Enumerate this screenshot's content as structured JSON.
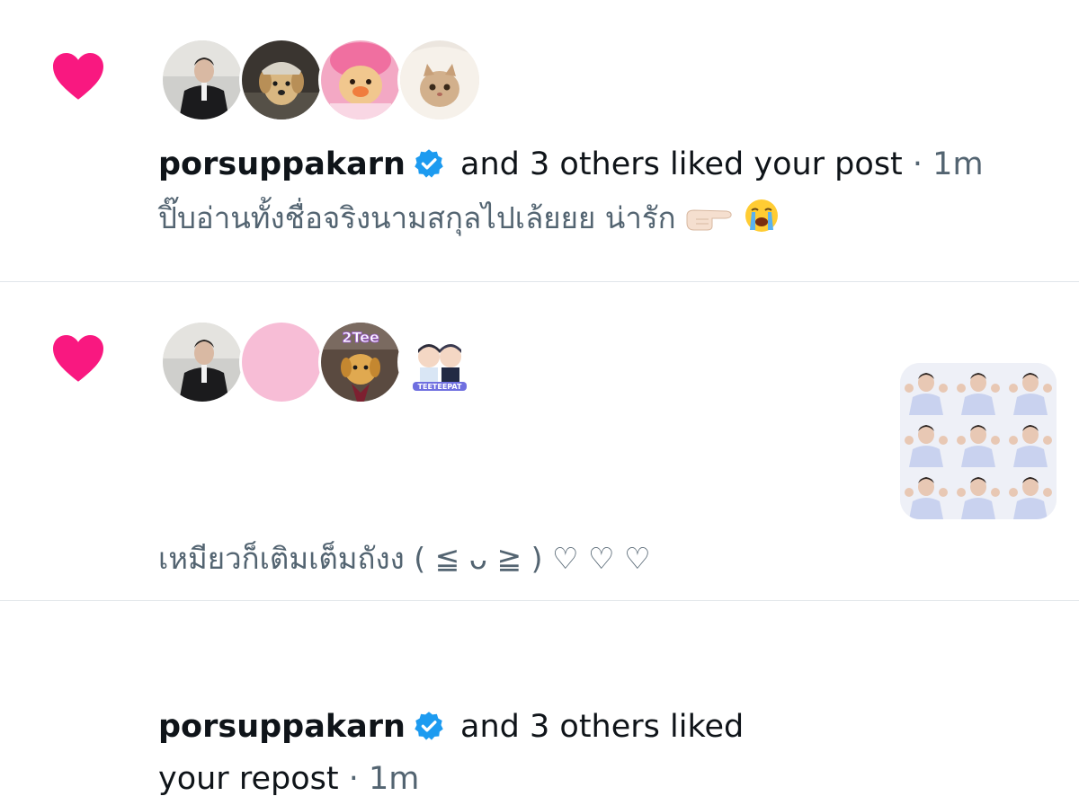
{
  "notifications": [
    {
      "username": "porsuppakarn",
      "action": " and 3 others liked your post",
      "separator": " · ",
      "time": "1m",
      "preview": "ปิ๊บอ่านทั้งชื่อจริงนามสกุลไปเล้ยยย น่ารัก",
      "preview_emoji": [
        "backhand-index-pointing-right",
        "loudly-crying-face"
      ],
      "avatars": [
        "person-dark-jacket",
        "puppy-with-cap",
        "plush-toy-pink",
        "cat-in-blanket"
      ]
    },
    {
      "username": "porsuppakarn",
      "action": " and 3 others liked",
      "action_cont": "your repost",
      "separator": " · ",
      "time": "1m",
      "preview": "เหมียวก็เติมเต็มถังง ( ≦ ᴗ ≧ ) ♡ ♡ ♡",
      "avatars": [
        "person-dark-jacket",
        "pink-blank",
        "puppy-2tee",
        "cartoon-couple-teeteepat"
      ],
      "thumbnail": "photo-grid-thumbnail"
    }
  ],
  "colors": {
    "like_heart": "#f91880",
    "verified": "#1d9bf0",
    "muted_text": "#536471",
    "divider": "#e1e6ea"
  }
}
